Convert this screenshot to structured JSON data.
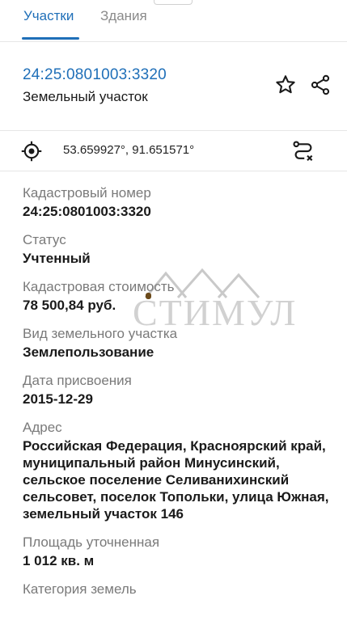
{
  "tabs": [
    {
      "label": "Участки",
      "active": true
    },
    {
      "label": "Здания",
      "active": false
    }
  ],
  "header": {
    "cadastral_link": "24:25:0801003:3320",
    "object_type": "Земельный участок",
    "star_icon": "star-outline-icon",
    "share_icon": "share-icon"
  },
  "coords_bar": {
    "location_icon": "crosshair-icon",
    "coordinates": "53.659927°, 91.651571°",
    "route_icon": "route-icon"
  },
  "fields": [
    {
      "label": "Кадастровый номер",
      "value": "24:25:0801003:3320"
    },
    {
      "label": "Статус",
      "value": "Учтенный"
    },
    {
      "label": "Кадастровая стоимость",
      "value": "78 500,84 руб."
    },
    {
      "label": "Вид земельного участка",
      "value": "Землепользование"
    },
    {
      "label": "Дата присвоения",
      "value": "2015-12-29"
    },
    {
      "label": "Адрес",
      "value": "Российская Федерация, Красноярский край, муниципальный район Минусинский, сельское поселение Селиванихинский сельсовет, поселок Топольки, улица Южная, земельный участок 146"
    },
    {
      "label": "Площадь уточненная",
      "value": "1 012 кв. м"
    },
    {
      "label": "Категория земель",
      "value": ""
    }
  ],
  "watermark": {
    "text": "СТИМУЛ"
  },
  "colors": {
    "accent": "#1f6fb8",
    "label": "#7a7a7a",
    "divider": "#e6e6e6"
  }
}
